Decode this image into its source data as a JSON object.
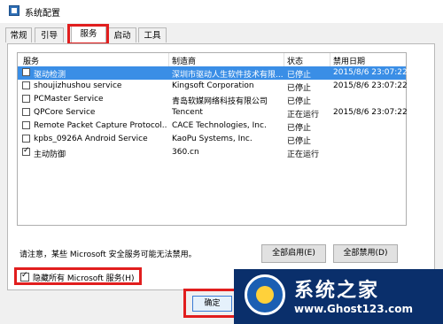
{
  "window": {
    "title": "系统配置"
  },
  "tabs": [
    {
      "label": "常规"
    },
    {
      "label": "引导"
    },
    {
      "label": "服务"
    },
    {
      "label": "启动"
    },
    {
      "label": "工具"
    }
  ],
  "table": {
    "headers": [
      "服务",
      "制造商",
      "状态",
      "禁用日期"
    ],
    "rows": [
      {
        "service": "驱动检测",
        "vendor": "深圳市驱动人生软件技术有限...",
        "status": "已停止",
        "date": "2015/8/6 23:07:22",
        "checked": false,
        "selected": true
      },
      {
        "service": "shoujizhushou service",
        "vendor": "Kingsoft Corporation",
        "status": "已停止",
        "date": "2015/8/6 23:07:22",
        "checked": false,
        "selected": false
      },
      {
        "service": "PCMaster Service",
        "vendor": "青岛软媒网络科技有限公司",
        "status": "已停止",
        "date": "",
        "checked": false,
        "selected": false
      },
      {
        "service": "QPCore Service",
        "vendor": "Tencent",
        "status": "正在运行",
        "date": "2015/8/6 23:07:22",
        "checked": false,
        "selected": false
      },
      {
        "service": "Remote Packet Capture Protocol...",
        "vendor": "CACE Technologies, Inc.",
        "status": "已停止",
        "date": "",
        "checked": false,
        "selected": false
      },
      {
        "service": "kpbs_0926A Android Service",
        "vendor": "KaoPu Systems, Inc.",
        "status": "已停止",
        "date": "",
        "checked": false,
        "selected": false
      },
      {
        "service": "主动防御",
        "vendor": "360.cn",
        "status": "正在运行",
        "date": "",
        "checked": true,
        "selected": false
      }
    ]
  },
  "note": "请注意，某些 Microsoft 安全服务可能无法禁用。",
  "buttons": {
    "enable_all": "全部启用(E)",
    "disable_all": "全部禁用(D)",
    "ok": "确定"
  },
  "hide_ms": {
    "label": "隐藏所有 Microsoft 服务(H)",
    "checked": true
  },
  "watermark": {
    "title": "系统之家",
    "url": "www.Ghost123.com"
  },
  "colors": {
    "highlight": "#e11e1e",
    "selection": "#3a8ee6"
  }
}
